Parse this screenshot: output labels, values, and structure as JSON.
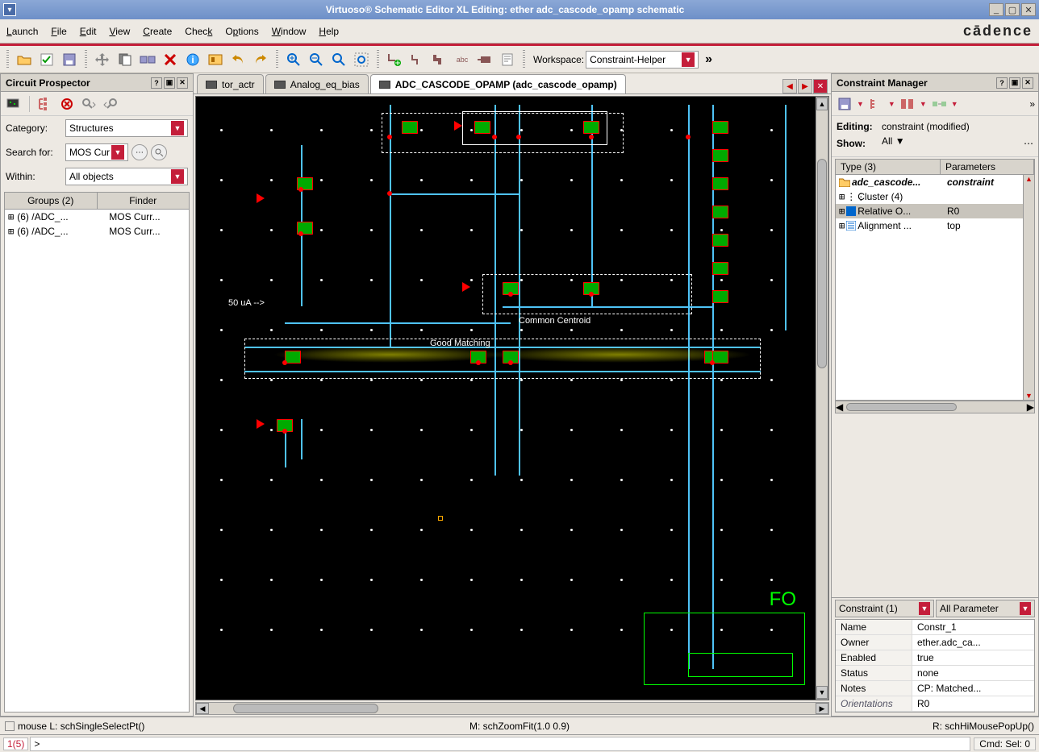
{
  "titlebar": {
    "title": "Virtuoso® Schematic Editor XL Editing: ether adc_cascode_opamp schematic"
  },
  "menubar": {
    "items": [
      "Launch",
      "File",
      "Edit",
      "View",
      "Create",
      "Check",
      "Options",
      "Window",
      "Help"
    ],
    "brand": "cādence"
  },
  "toolbar": {
    "workspace_label": "Workspace:",
    "workspace_value": "Constraint-Helper"
  },
  "prospector": {
    "title": "Circuit Prospector",
    "category_label": "Category:",
    "category_value": "Structures",
    "search_label": "Search for:",
    "search_value": "MOS Cur",
    "within_label": "Within:",
    "within_value": "All objects",
    "headers": [
      "Groups (2)",
      "Finder"
    ],
    "rows": [
      {
        "g": "(6) /ADC_...",
        "f": "MOS Curr..."
      },
      {
        "g": "(6) /ADC_...",
        "f": "MOS Curr..."
      }
    ]
  },
  "tabs": {
    "items": [
      {
        "label": "tor_actr"
      },
      {
        "label": "Analog_eq_bias"
      },
      {
        "label": "ADC_CASCODE_OPAMP (adc_cascode_opamp)"
      }
    ],
    "active": 2
  },
  "canvas": {
    "anno_50ua": "50 uA -->",
    "anno_cc": "Common Centroid",
    "anno_gm": "Good Matching",
    "anno_fo": "FO"
  },
  "cm": {
    "title": "Constraint Manager",
    "editing_label": "Editing:",
    "editing_value": "constraint (modified)",
    "show_label": "Show:",
    "show_value": "All",
    "headers": [
      "Type (3)",
      "Parameters"
    ],
    "rows": [
      {
        "c1": "adc_cascode...",
        "c2": "constraint",
        "hdr": true
      },
      {
        "c1": "Cluster (4)",
        "c2": ""
      },
      {
        "c1": "Relative O...",
        "c2": "R0",
        "sel": true
      },
      {
        "c1": "Alignment ...",
        "c2": "top"
      }
    ],
    "filter1": "Constraint (1)",
    "filter2": "All Parameter",
    "props": [
      {
        "n": "Name",
        "v": "Constr_1"
      },
      {
        "n": "Owner",
        "v": "ether.adc_ca..."
      },
      {
        "n": "Enabled",
        "v": "true"
      },
      {
        "n": "Status",
        "v": "none"
      },
      {
        "n": "Notes",
        "v": "CP: Matched..."
      },
      {
        "n": "Orientations",
        "v": "R0",
        "it": true
      }
    ]
  },
  "status": {
    "left": "mouse L: schSingleSelectPt()",
    "mid": "M: schZoomFit(1.0 0.9)",
    "right": "R: schHiMousePopUp()"
  },
  "cmdbar": {
    "count": "1(5)",
    "prompt": ">",
    "cmdsel": "Cmd: Sel: 0"
  }
}
